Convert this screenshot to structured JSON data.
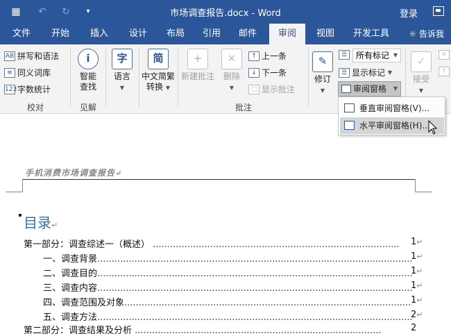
{
  "titlebar": {
    "doc_title": "市场调查报告.docx - Word",
    "login": "登录"
  },
  "tabs": [
    "文件",
    "开始",
    "插入",
    "设计",
    "布局",
    "引用",
    "邮件",
    "审阅",
    "视图",
    "开发工具"
  ],
  "active_tab": "审阅",
  "tellme": "告诉我",
  "ribbon": {
    "proofing": {
      "spelling": "拼写和语法",
      "thesaurus": "同义词库",
      "word_count": "字数统计",
      "label": "校对"
    },
    "insights": {
      "smart_lookup": "智能\n查找",
      "label": "见解"
    },
    "language": {
      "label": "语言"
    },
    "chinese": {
      "convert": "中文简繁\n转换"
    },
    "comments": {
      "new": "新建批注",
      "delete": "删除",
      "prev": "上一条",
      "next": "下一条",
      "show": "显示批注",
      "label": "批注"
    },
    "tracking": {
      "track": "修订",
      "markup_select": "所有标记",
      "show_markup": "显示标记",
      "pane": "审阅窗格"
    },
    "accept": "接受"
  },
  "pane_menu": {
    "vertical": "垂直审阅窗格(V)...",
    "horizontal": "水平审阅窗格(H)..."
  },
  "document": {
    "header": "手机消费市场调查报告",
    "toc_title": "目录",
    "toc": [
      {
        "text": "第一部分：调查综述一（概述）",
        "page": "1"
      },
      {
        "text": "一、调查背景",
        "page": "1"
      },
      {
        "text": "二、调查目的",
        "page": "1"
      },
      {
        "text": "三、调查内容",
        "page": "1"
      },
      {
        "text": "四、调查范围及对象",
        "page": "1"
      },
      {
        "text": "五、调查方法",
        "page": "2"
      },
      {
        "text": "第二部分：调查结果及分析",
        "page": "2"
      }
    ]
  }
}
